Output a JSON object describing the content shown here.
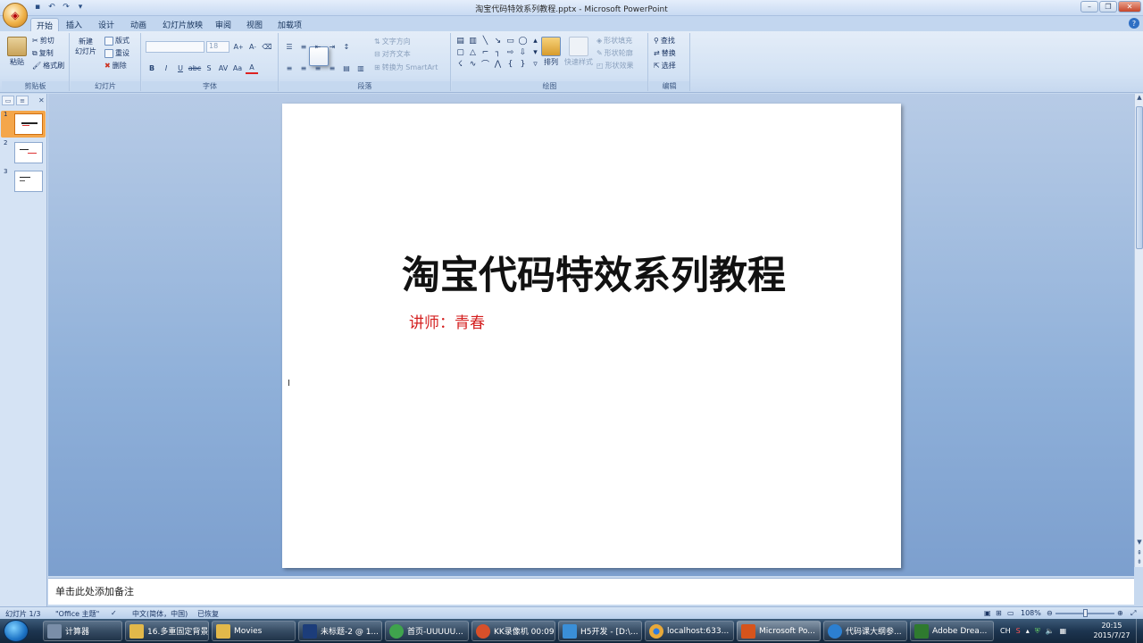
{
  "window": {
    "title": "淘宝代码特效系列教程.pptx - Microsoft PowerPoint",
    "office_button_badge": "76"
  },
  "ribbon": {
    "tabs": [
      "开始",
      "插入",
      "设计",
      "动画",
      "幻灯片放映",
      "审阅",
      "视图",
      "加载项"
    ],
    "active_tab": "开始",
    "clipboard": {
      "paste": "粘贴",
      "cut": "剪切",
      "copy": "复制",
      "format_painter": "格式刷",
      "label": "剪贴板"
    },
    "slides": {
      "new_slide": "新建",
      "new_slide2": "幻灯片",
      "layout": "版式",
      "reset": "重设",
      "delete": "删除",
      "label": "幻灯片"
    },
    "font": {
      "size": "18",
      "label": "字体"
    },
    "paragraph": {
      "text_direction": "文字方向",
      "align_text": "对齐文本",
      "smartart": "转换为 SmartArt",
      "label": "段落"
    },
    "drawing": {
      "arrange": "排列",
      "quick_styles": "快速样式",
      "shape_fill": "形状填充",
      "shape_outline": "形状轮廓",
      "shape_effects": "形状效果",
      "label": "绘图"
    },
    "editing": {
      "find": "查找",
      "replace": "替换",
      "select": "选择",
      "label": "编辑"
    }
  },
  "slide_pane": {
    "thumbnails": [
      {
        "num": "1",
        "active": true
      },
      {
        "num": "2",
        "active": false
      },
      {
        "num": "3",
        "active": false
      }
    ]
  },
  "slide": {
    "title": "淘宝代码特效系列教程",
    "subtitle": "讲师：青春"
  },
  "notes": {
    "placeholder": "单击此处添加备注"
  },
  "statusbar": {
    "slide_info": "幻灯片 1/3",
    "theme": "\"Office 主题\"",
    "language": "中文(简体，中国)",
    "recovered": "已恢复",
    "zoom": "108%"
  },
  "taskbar": {
    "tasks": [
      {
        "label": "计算器",
        "color": "#7a8ea8"
      },
      {
        "label": "16.多重固定背景",
        "color": "#e2b84a"
      },
      {
        "label": "Movies",
        "color": "#e2b84a"
      },
      {
        "label": "未标题-2 @ 1...",
        "color": "#1c3d7a"
      },
      {
        "label": "首页-UUUUU...",
        "color": "#3fa34d"
      },
      {
        "label": "KK录像机 00:09",
        "color": "#d8502a"
      },
      {
        "label": "H5开发 - [D:\\...",
        "color": "#3a8fd8"
      },
      {
        "label": "localhost:633...",
        "color": "#e8a93a"
      },
      {
        "label": "Microsoft Po...",
        "color": "#d6541c"
      },
      {
        "label": "代码课大纲参...",
        "color": "#2c7fd0"
      },
      {
        "label": "Adobe Drea...",
        "color": "#2f7a2f"
      }
    ],
    "tray_lang": "CH",
    "time": "20:15",
    "date": "2015/7/27"
  }
}
